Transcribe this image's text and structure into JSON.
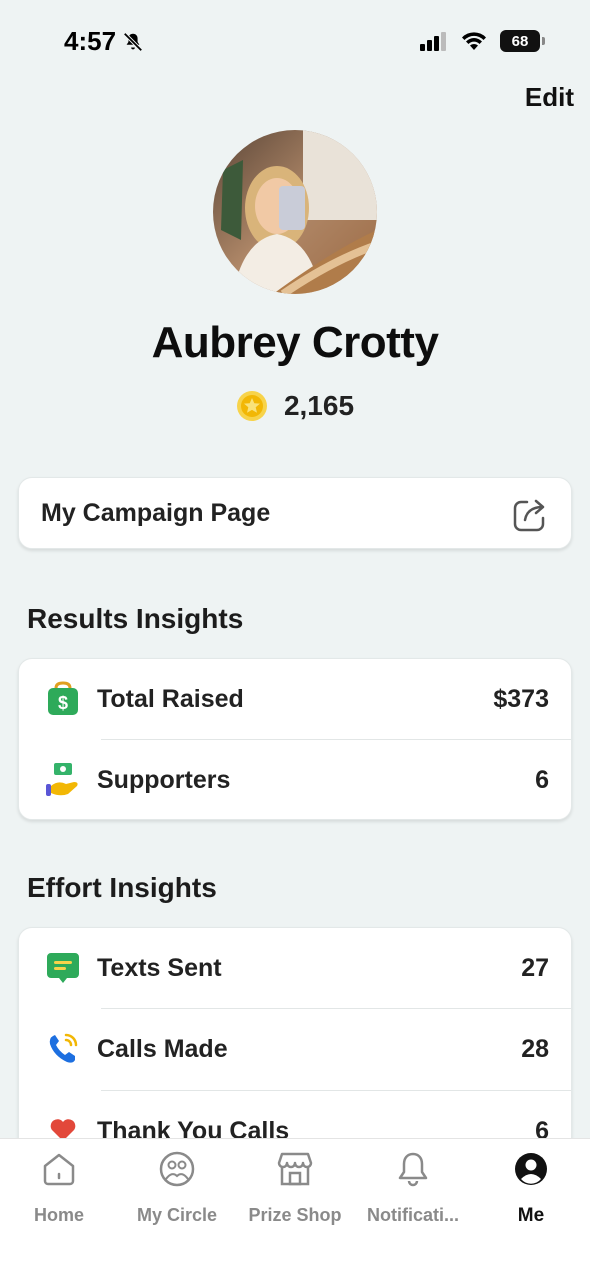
{
  "status_bar": {
    "time": "4:57",
    "battery": "68"
  },
  "header": {
    "edit_label": "Edit"
  },
  "profile": {
    "name": "Aubrey Crotty",
    "points": "2,165"
  },
  "campaign": {
    "label": "My Campaign Page"
  },
  "results": {
    "title": "Results Insights",
    "rows": [
      {
        "label": "Total Raised",
        "value": "$373",
        "icon": "money-bag-icon"
      },
      {
        "label": "Supporters",
        "value": "6",
        "icon": "hand-money-icon"
      }
    ]
  },
  "effort": {
    "title": "Effort Insights",
    "rows": [
      {
        "label": "Texts Sent",
        "value": "27",
        "icon": "message-icon"
      },
      {
        "label": "Calls Made",
        "value": "28",
        "icon": "phone-icon"
      },
      {
        "label": "Thank You Calls",
        "value": "6",
        "icon": "heart-icon"
      }
    ]
  },
  "tab_bar": {
    "tabs": [
      {
        "label": "Home",
        "icon": "home-icon"
      },
      {
        "label": "My Circle",
        "icon": "circle-faces-icon"
      },
      {
        "label": "Prize Shop",
        "icon": "shop-icon"
      },
      {
        "label": "Notificati...",
        "icon": "bell-icon"
      },
      {
        "label": "Me",
        "icon": "person-icon",
        "active": true
      }
    ]
  },
  "colors": {
    "background": "#eef3f3",
    "accent_green": "#2eaa5a",
    "coin_gold": "#f5c518"
  }
}
